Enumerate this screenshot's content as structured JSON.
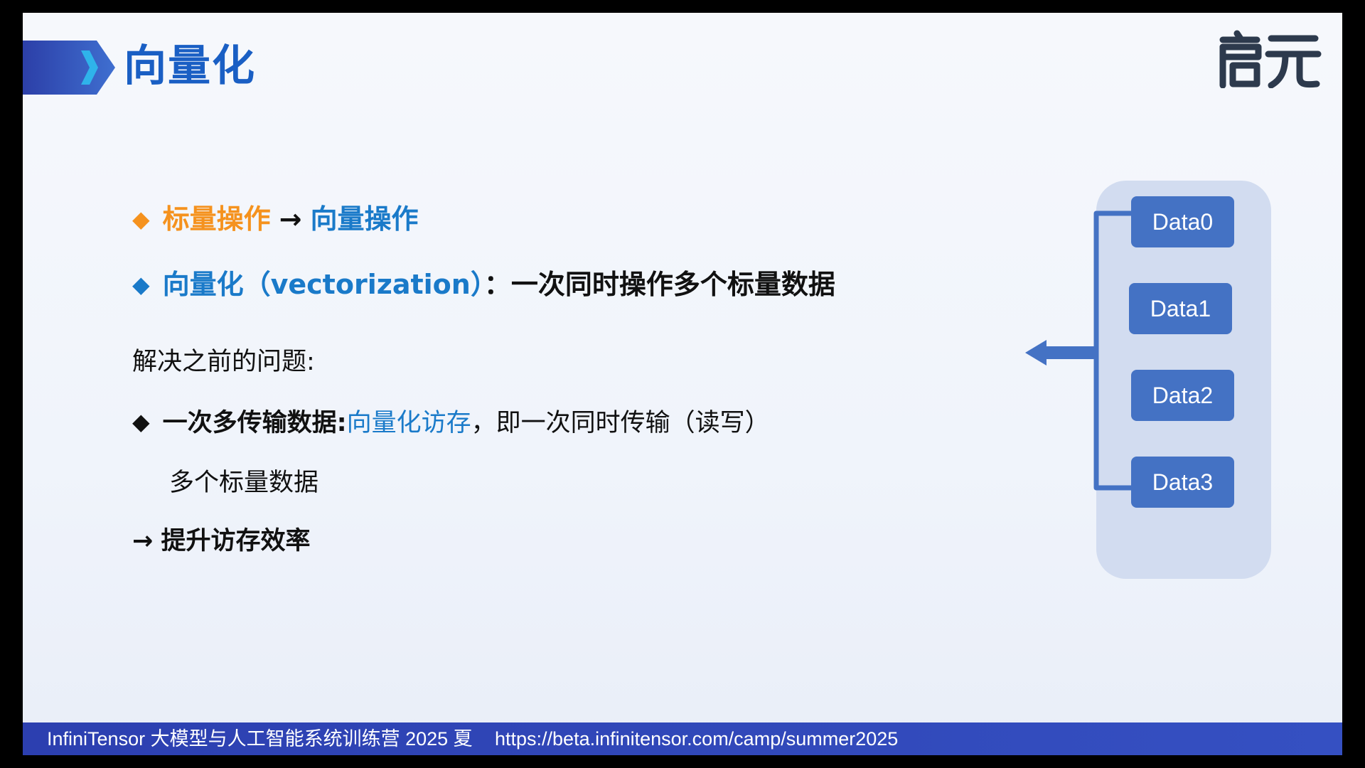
{
  "header": {
    "title": "向量化",
    "logo_text": "启元"
  },
  "content": {
    "bullet1": {
      "left": "标量操作",
      "arrow": "→",
      "right": "向量操作"
    },
    "bullet2": {
      "term": "向量化（vectorization）",
      "colon": "：",
      "definition": "一次同时操作多个标量数据"
    },
    "problem_label": "解决之前的问题:",
    "bullet3": {
      "label": "一次多传输数据:",
      "highlight": "向量化访存",
      "rest": "，即一次同时传输（读写）",
      "continuation": "多个标量数据"
    },
    "conclusion": {
      "arrow": "→",
      "text": "提升访存效率"
    }
  },
  "diagram": {
    "boxes": [
      "Data0",
      "Data1",
      "Data2",
      "Data3"
    ],
    "colors": {
      "panel": "#d2dcf0",
      "box": "#4472c4",
      "line": "#4472c4"
    }
  },
  "footer": {
    "event": "InfiniTensor 大模型与人工智能系统训练营 2025 夏",
    "url": "https://beta.infinitensor.com/camp/summer2025"
  },
  "colors": {
    "title": "#1a5fc4",
    "accent_orange": "#f5921e",
    "accent_blue": "#1a7ac9",
    "footer_bg": "#3048b8"
  }
}
